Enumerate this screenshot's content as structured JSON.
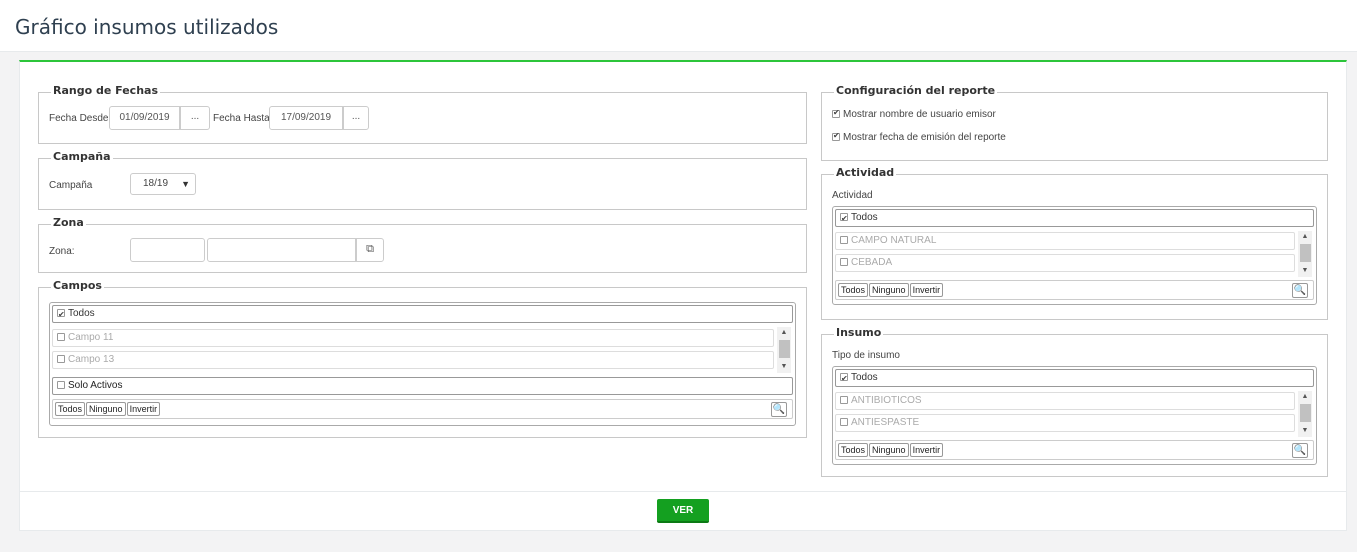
{
  "page": {
    "title": "Gráfico insumos utilizados"
  },
  "rango": {
    "legend": "Rango de Fechas",
    "desde_label": "Fecha Desde",
    "desde_value": "01/09/2019",
    "hasta_label": "Fecha Hasta",
    "hasta_value": "17/09/2019",
    "picker_label": "..."
  },
  "campana": {
    "legend": "Campaña",
    "label": "Campaña",
    "selected": "18/19",
    "caret": "▼"
  },
  "zona": {
    "legend": "Zona",
    "label": "Zona:",
    "code_value": "",
    "name_value": "",
    "link_icon": "⧉"
  },
  "campos": {
    "legend": "Campos",
    "todos": "Todos",
    "items": [
      "Campo 11",
      "Campo 13"
    ],
    "solo_activos": "Solo Activos",
    "btn_todos": "Todos",
    "btn_ninguno": "Ninguno",
    "btn_invertir": "Invertir"
  },
  "config": {
    "legend": "Configuración del reporte",
    "opt1": "Mostrar nombre de usuario emisor",
    "opt2": "Mostrar fecha de emisión del reporte"
  },
  "actividad": {
    "legend": "Actividad",
    "label": "Actividad",
    "todos": "Todos",
    "items": [
      "CAMPO NATURAL",
      "CEBADA"
    ],
    "btn_todos": "Todos",
    "btn_ninguno": "Ninguno",
    "btn_invertir": "Invertir"
  },
  "insumo": {
    "legend": "Insumo",
    "label": "Tipo de insumo",
    "todos": "Todos",
    "items": [
      "ANTIBIOTICOS",
      "ANTIESPASTE"
    ],
    "btn_todos": "Todos",
    "btn_ninguno": "Ninguno",
    "btn_invertir": "Invertir"
  },
  "footer": {
    "ver_label": "VER"
  },
  "icons": {
    "search": "🔍",
    "scroll_up": "▲",
    "scroll_down": "▼"
  },
  "colors": {
    "accent": "#2cc53a",
    "button": "#14a020"
  }
}
